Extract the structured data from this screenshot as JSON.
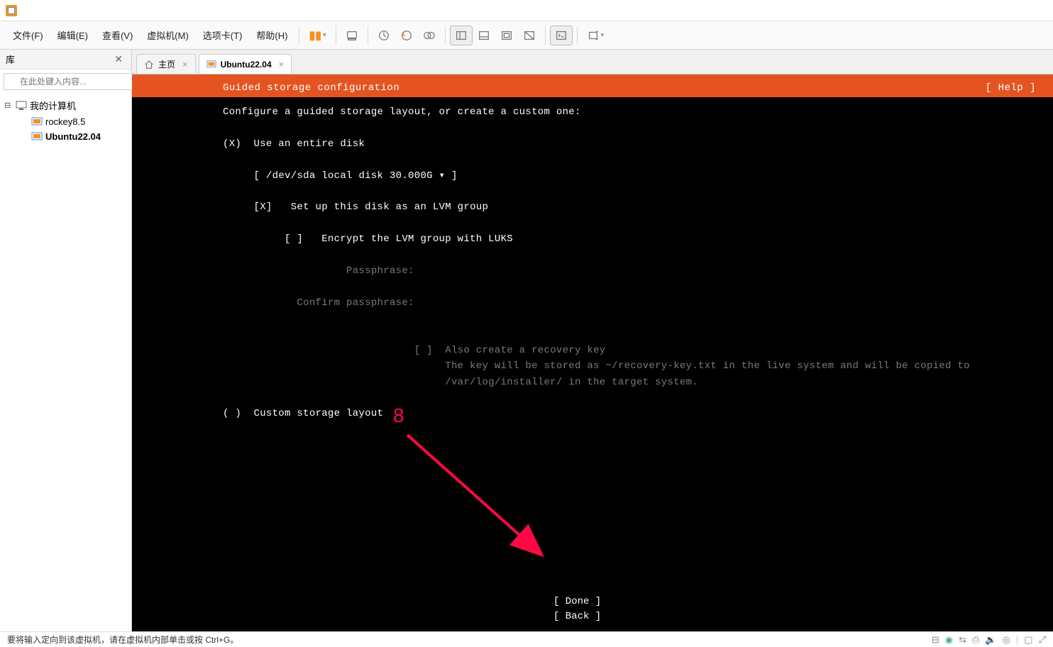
{
  "menus": {
    "file": "文件(F)",
    "edit": "编辑(E)",
    "view": "查看(V)",
    "vm": "虚拟机(M)",
    "tabs": "选项卡(T)",
    "help": "帮助(H)"
  },
  "sidebar": {
    "title": "库",
    "search_placeholder": "在此处键入内容...",
    "root": "我的计算机",
    "items": [
      "rockey8.5",
      "Ubuntu22.04"
    ]
  },
  "tabs": {
    "home": "主页",
    "active": "Ubuntu22.04"
  },
  "installer": {
    "title": "Guided storage configuration",
    "help": "[ Help ]",
    "subtitle": "Configure a guided storage layout, or create a custom one:",
    "opt_entire_disk": "(X)  Use an entire disk",
    "disk_selector": "[ /dev/sda local disk 30.000G ▾ ]",
    "lvm_check": "[X]   Set up this disk as an LVM group",
    "encrypt_check": "[ ]   Encrypt the LVM group with LUKS",
    "passphrase_label": "Passphrase:",
    "confirm_label": "Confirm passphrase:",
    "recovery_check": "[ ]",
    "recovery_label": "Also create a recovery key",
    "recovery_desc1": "The key will be stored as ~/recovery-key.txt in the live system and will be copied to",
    "recovery_desc2": "/var/log/installer/ in the target system.",
    "opt_custom": "( )  Custom storage layout",
    "done_btn": "[ Done       ]",
    "back_btn": "[ Back       ]"
  },
  "annotation_number": "8",
  "status": {
    "text": "要将输入定向到该虚拟机，请在虚拟机内部单击或按 Ctrl+G。"
  }
}
